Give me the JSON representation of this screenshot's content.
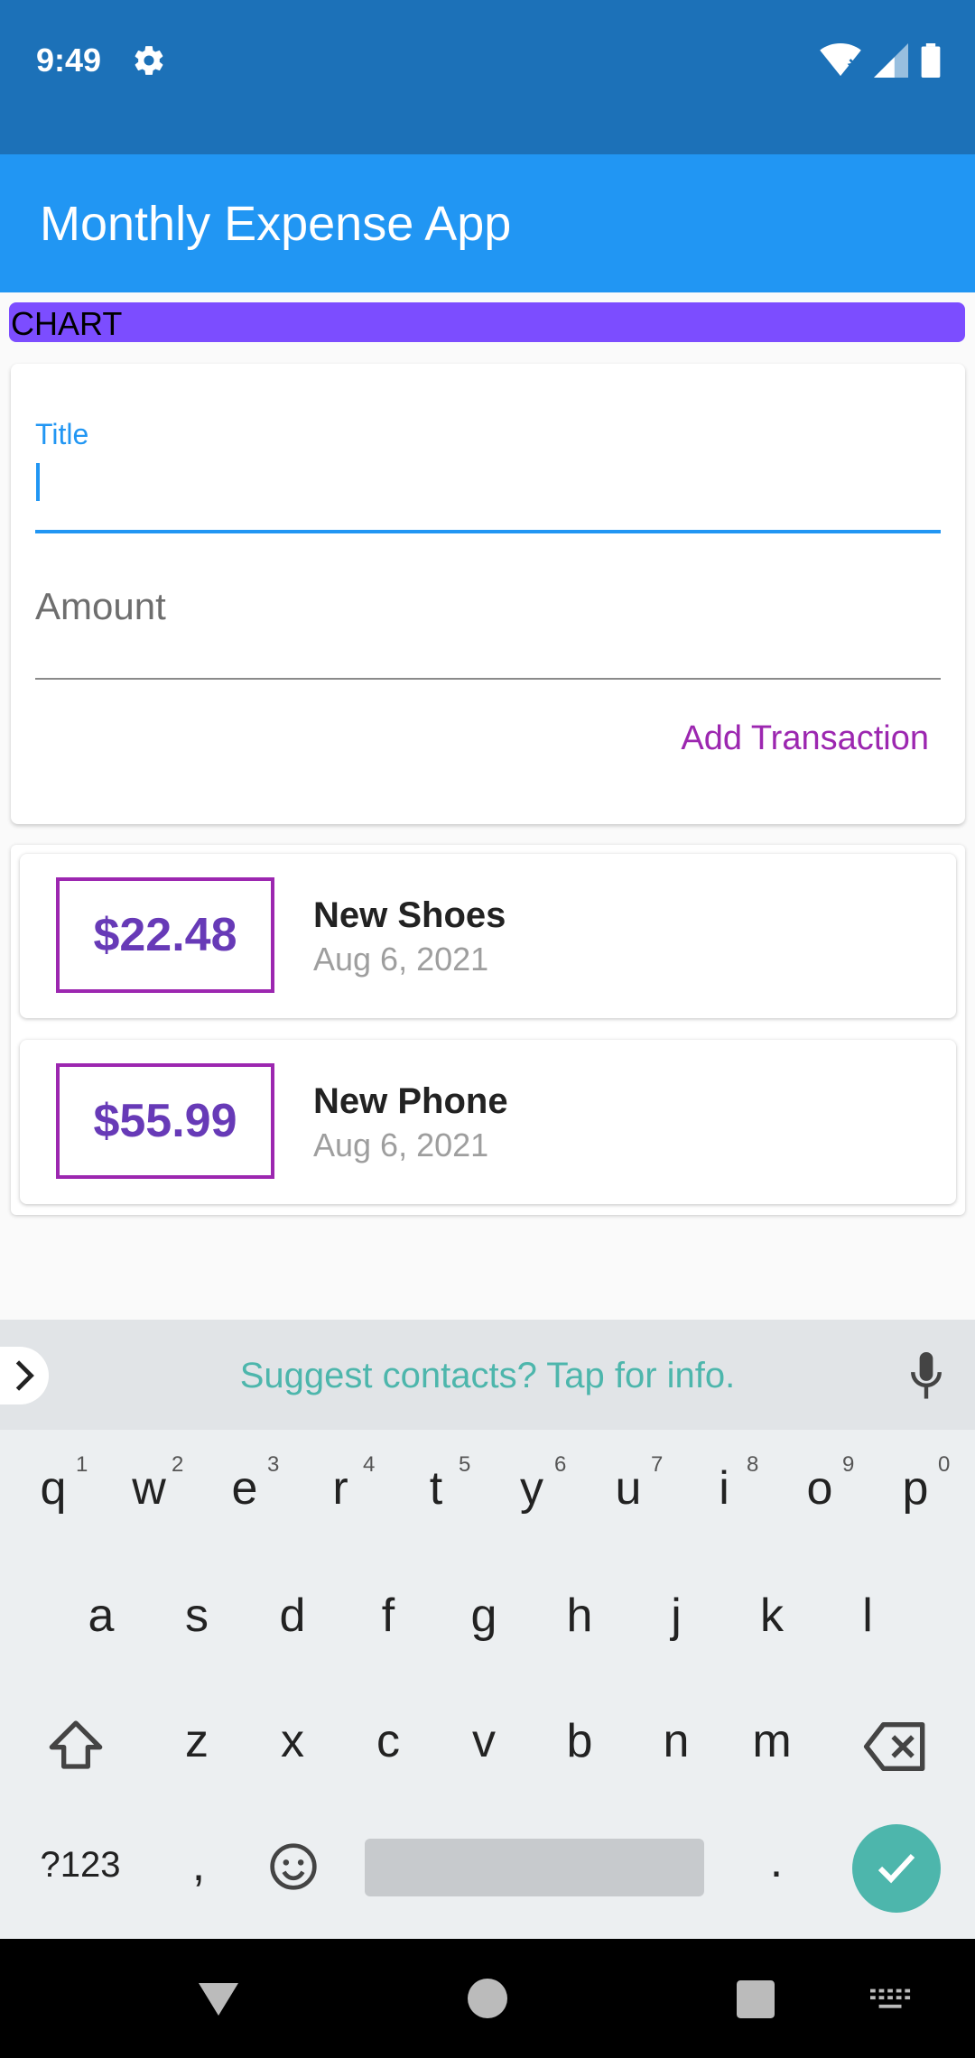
{
  "status_bar": {
    "time": "9:49"
  },
  "app_bar": {
    "title": "Monthly Expense App"
  },
  "chart": {
    "label": "CHART"
  },
  "form": {
    "title_label": "Title",
    "amount_placeholder": "Amount",
    "add_button": "Add Transaction"
  },
  "transactions": [
    {
      "amount": "$22.48",
      "title": "New Shoes",
      "date": "Aug 6, 2021"
    },
    {
      "amount": "$55.99",
      "title": "New Phone",
      "date": "Aug 6, 2021"
    }
  ],
  "keyboard": {
    "suggestion": "Suggest contacts? Tap for info.",
    "row1": [
      "q",
      "w",
      "e",
      "r",
      "t",
      "y",
      "u",
      "i",
      "o",
      "p"
    ],
    "row1_hints": [
      "1",
      "2",
      "3",
      "4",
      "5",
      "6",
      "7",
      "8",
      "9",
      "0"
    ],
    "row2": [
      "a",
      "s",
      "d",
      "f",
      "g",
      "h",
      "j",
      "k",
      "l"
    ],
    "row3": [
      "z",
      "x",
      "c",
      "v",
      "b",
      "n",
      "m"
    ],
    "symbols_key": "?123",
    "comma_key": ",",
    "period_key": "."
  },
  "colors": {
    "status_bar": "#1C71B8",
    "app_bar": "#2196F3",
    "chart": "#7C4DFF",
    "accent": "#9C27B0",
    "amount_text": "#673AB7",
    "keyboard_accent": "#4DB6AC"
  }
}
